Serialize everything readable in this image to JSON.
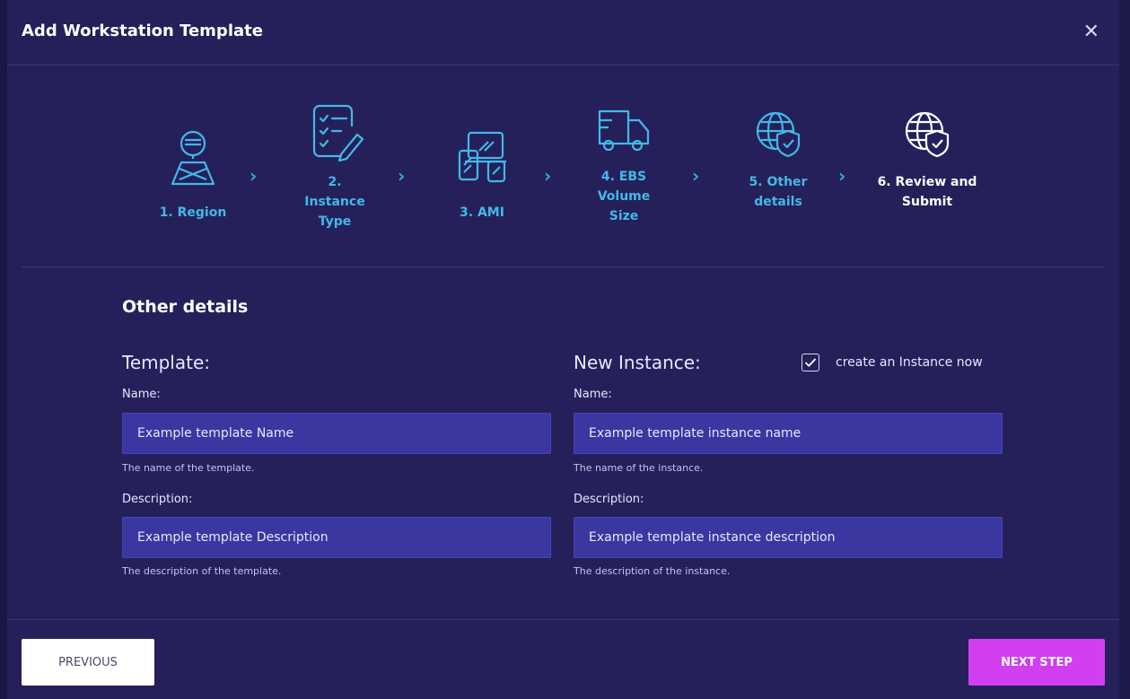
{
  "dialog": {
    "title": "Add Workstation Template",
    "close_icon": "close-icon"
  },
  "steps": [
    {
      "label": "1. Region",
      "icon": "map-location-icon",
      "state": "completed"
    },
    {
      "label": "2. Instance Type",
      "icon": "checklist-edit-icon",
      "state": "completed"
    },
    {
      "label": "3. AMI",
      "icon": "devices-icon",
      "state": "completed"
    },
    {
      "label": "4. EBS Volume Size",
      "icon": "truck-icon",
      "state": "completed"
    },
    {
      "label": "5. Other details",
      "icon": "globe-shield-icon",
      "state": "completed"
    },
    {
      "label": "6. Review and Submit",
      "icon": "globe-shield-icon",
      "state": "active"
    }
  ],
  "section": {
    "title": "Other details"
  },
  "template": {
    "heading": "Template:",
    "name_label": "Name:",
    "name_value": "Example template Name",
    "name_hint": "The name of the template.",
    "description_label": "Description:",
    "description_value": "Example template Description",
    "description_hint": "The description of the template."
  },
  "instance": {
    "heading": "New Instance:",
    "create_checkbox_label": "create an Instance now",
    "create_checked": true,
    "name_label": "Name:",
    "name_value": "Example template instance name",
    "name_hint": "The name of the instance.",
    "description_label": "Description:",
    "description_value": "Example template instance description",
    "description_hint": "The description of the instance."
  },
  "footer": {
    "previous_label": "PREVIOUS",
    "next_label": "NEXT STEP"
  },
  "colors": {
    "background": "#25205a",
    "step_inactive": "#43b8e8",
    "input_bg": "#3b37a0",
    "next_button": "#d13ff0"
  }
}
